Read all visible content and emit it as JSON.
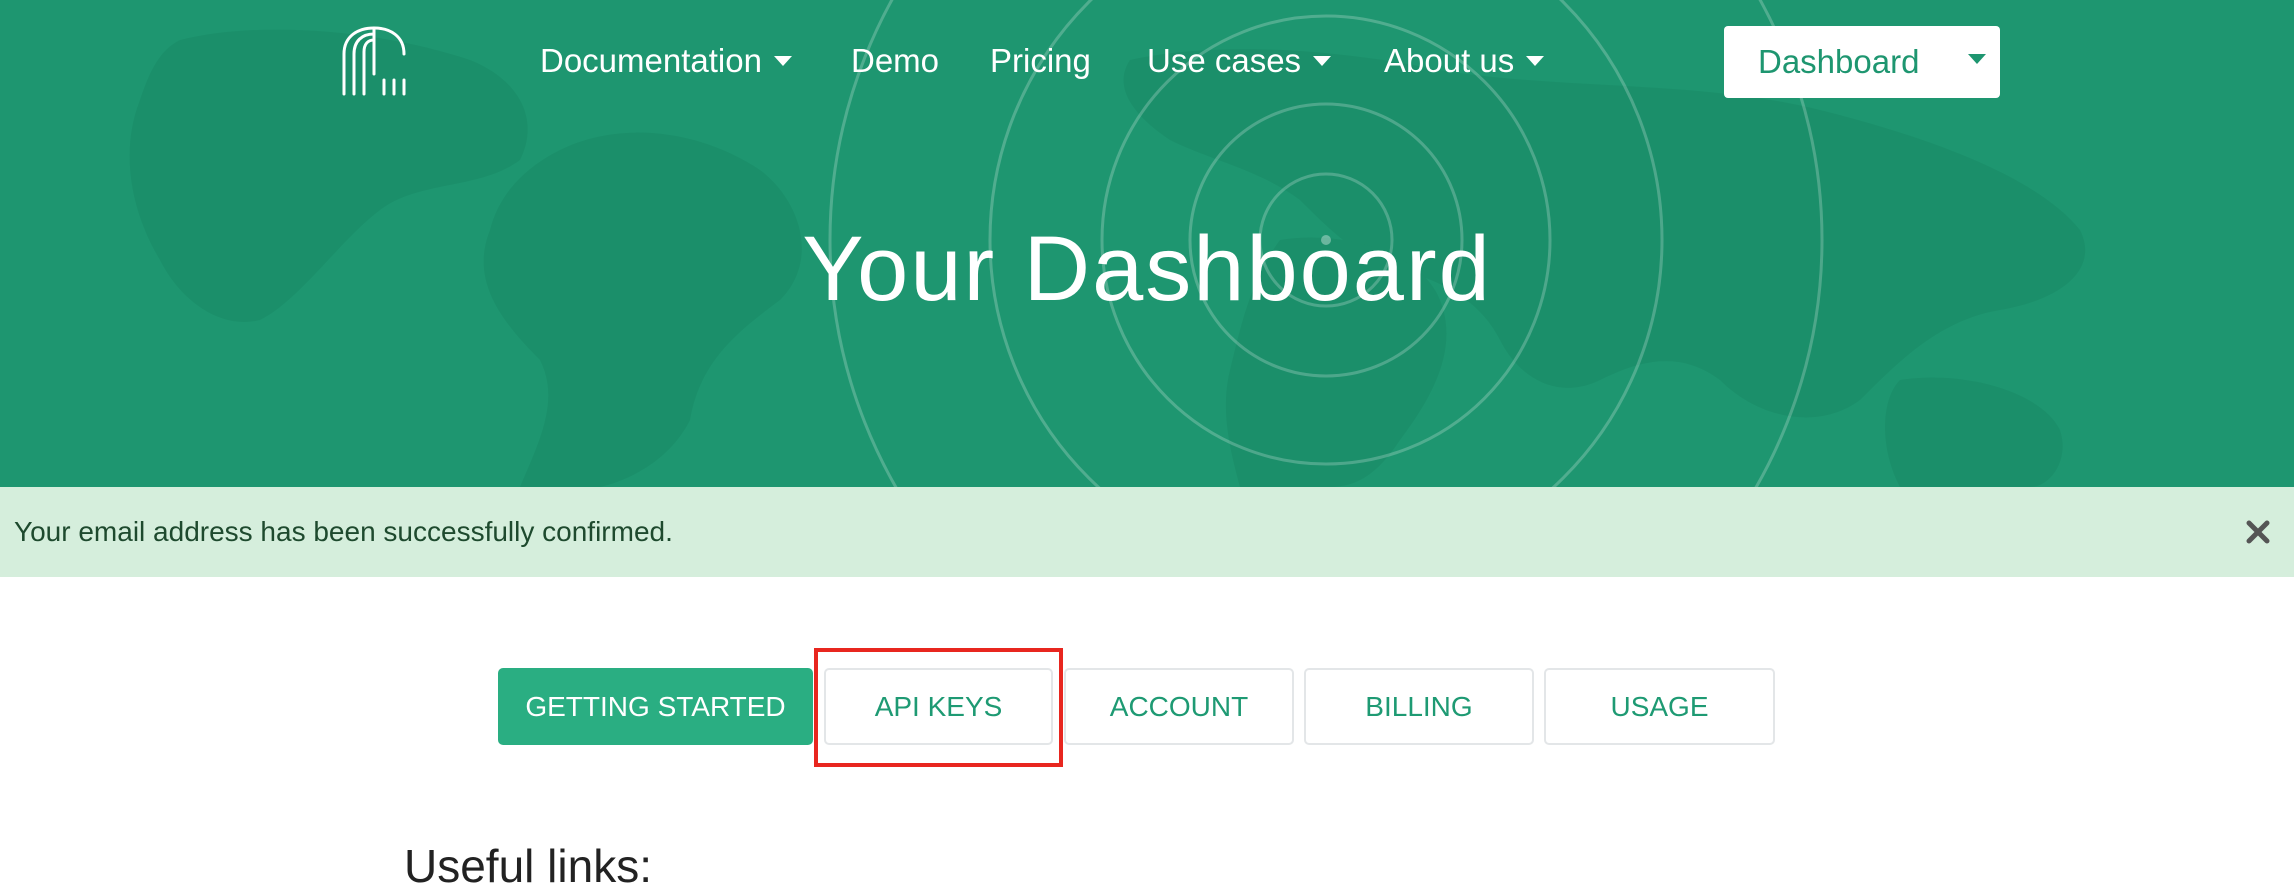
{
  "nav": {
    "items": [
      {
        "label": "Documentation",
        "has_dropdown": true
      },
      {
        "label": "Demo",
        "has_dropdown": false
      },
      {
        "label": "Pricing",
        "has_dropdown": false
      },
      {
        "label": "Use cases",
        "has_dropdown": true
      },
      {
        "label": "About us",
        "has_dropdown": true
      }
    ],
    "dashboard_button": "Dashboard"
  },
  "hero": {
    "title": "Your Dashboard"
  },
  "alert": {
    "message": "Your email address has been successfully confirmed."
  },
  "tabs": [
    {
      "label": "GETTING STARTED",
      "active": true
    },
    {
      "label": "API KEYS",
      "active": false
    },
    {
      "label": "ACCOUNT",
      "active": false
    },
    {
      "label": "BILLING",
      "active": false
    },
    {
      "label": "USAGE",
      "active": false
    }
  ],
  "content": {
    "heading": "Useful links:"
  },
  "colors": {
    "brand_green": "#1e9670",
    "tab_active": "#2aae82",
    "alert_bg": "#d5eedc",
    "highlight_red": "#e8261f"
  },
  "icons": {
    "logo": "birdcage-logo-icon",
    "close": "close-icon",
    "dropdown": "caret-down-icon"
  }
}
